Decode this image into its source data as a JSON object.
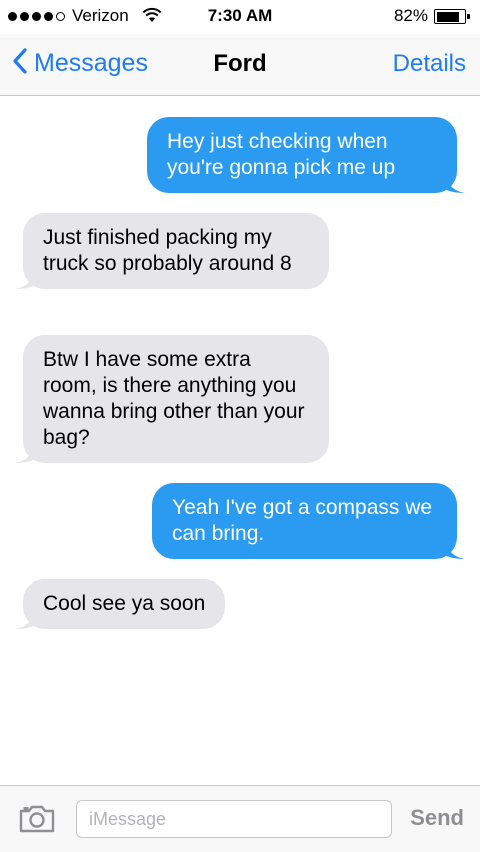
{
  "status_bar": {
    "carrier": "Verizon",
    "signal_bars_filled": 4,
    "signal_bars_total": 5,
    "time": "7:30 AM",
    "battery_percent": "82%",
    "battery_level": 0.82
  },
  "nav": {
    "back_label": "Messages",
    "title": "Ford",
    "details_label": "Details"
  },
  "messages": [
    {
      "direction": "outgoing",
      "text": "Hey just checking when you're gonna pick me up"
    },
    {
      "direction": "incoming",
      "text": "Just finished packing my truck so probably around 8"
    },
    {
      "direction": "incoming",
      "text": "Btw I have some extra room, is there anything you wanna bring other than your bag?"
    },
    {
      "direction": "outgoing",
      "text": "Yeah I've got a compass we can bring."
    },
    {
      "direction": "incoming",
      "text": "Cool see ya soon"
    }
  ],
  "input": {
    "placeholder": "iMessage",
    "value": "",
    "send_label": "Send"
  },
  "colors": {
    "outgoing_bubble": "#2a9bf0",
    "incoming_bubble": "#e5e5ea",
    "accent": "#1e7cf2"
  }
}
